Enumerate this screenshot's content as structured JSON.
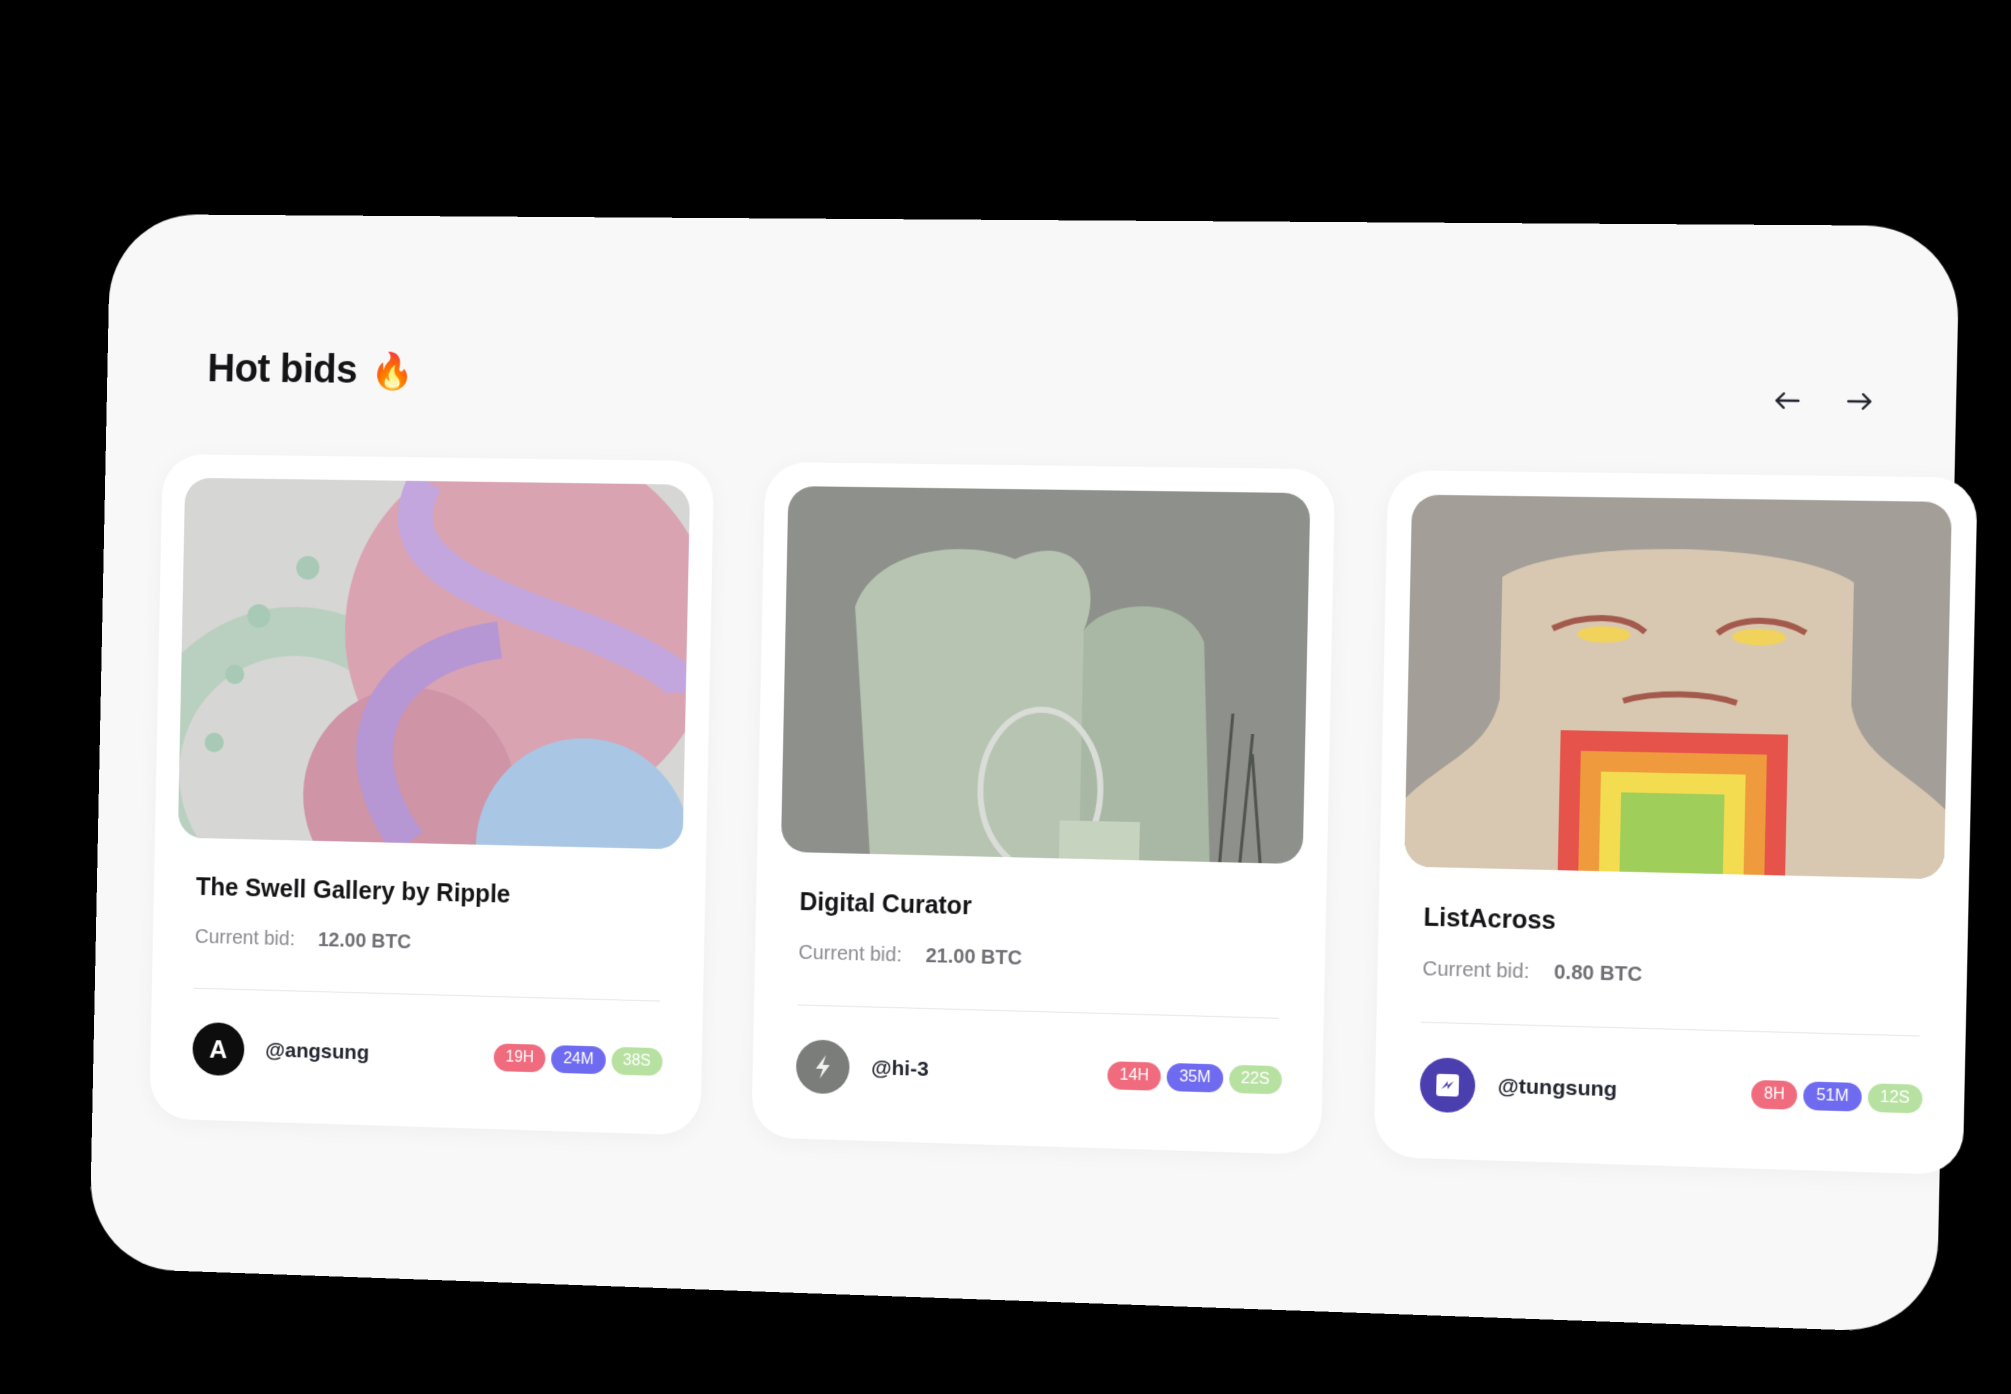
{
  "header": {
    "title": "Hot bids",
    "title_icon": "🔥"
  },
  "nav": {
    "prev_icon": "arrow-left-icon",
    "next_icon": "arrow-right-icon"
  },
  "colors": {
    "hours": "#ef6b7d",
    "minutes": "#6f6bf0",
    "seconds": "#b7e1a1"
  },
  "cards": [
    {
      "title": "The Swell Gallery by Ripple",
      "bid_label": "Current bid:",
      "bid_value": "12.00 BTC",
      "handle": "@angsung",
      "avatar_letter": "A",
      "timer": {
        "h": "19H",
        "m": "24M",
        "s": "38S"
      }
    },
    {
      "title": "Digital Curator",
      "bid_label": "Current bid:",
      "bid_value": "21.00 BTC",
      "handle": "@hi-3",
      "avatar_letter": "",
      "timer": {
        "h": "14H",
        "m": "35M",
        "s": "22S"
      }
    },
    {
      "title": "ListAcross",
      "bid_label": "Current bid:",
      "bid_value": "0.80 BTC",
      "handle": "@tungsung",
      "avatar_letter": "",
      "timer": {
        "h": "8H",
        "m": "51M",
        "s": "12S"
      }
    }
  ]
}
